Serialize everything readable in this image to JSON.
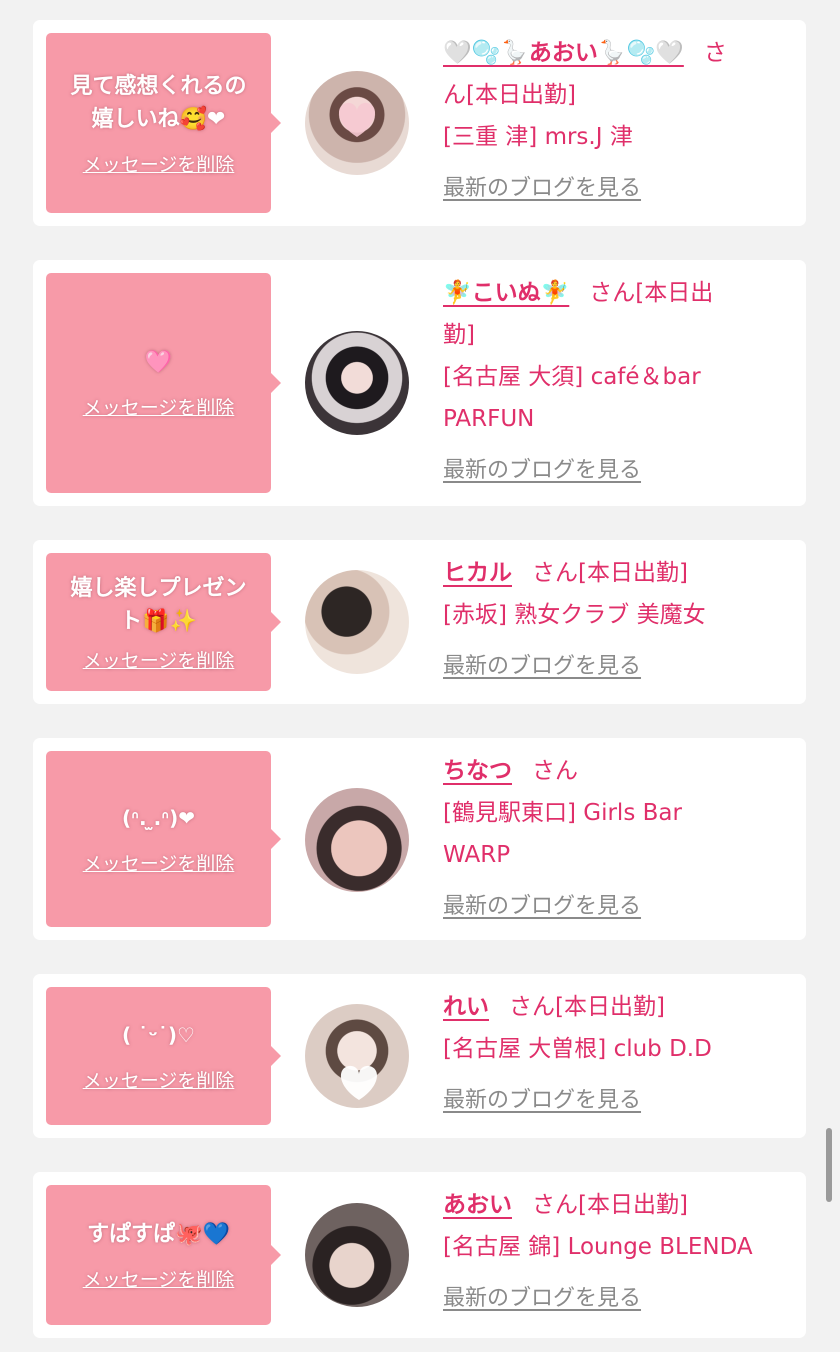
{
  "accent_color": "#e02f6a",
  "bubble_color": "#f79aa8",
  "delete_label": "メッセージを削除",
  "blog_label": "最新のブログを見る",
  "cards": [
    {
      "message": "見て感想くれるの\n嬉しいね🥰❤",
      "name": "🤍🫧🪿あおい🪿🫧🤍",
      "san_line": "さ",
      "line2": "ん[本日出勤]",
      "line3": "[三重 津] mrs.J 津",
      "line4": ""
    },
    {
      "message": "🩷",
      "name": "🧚こいぬ🧚",
      "san_line": "さん[本日出",
      "line2": "勤]",
      "line3": "[名古屋 大須] café＆bar",
      "line4": "PARFUN"
    },
    {
      "message": "嬉し楽しプレゼン\nト🎁✨",
      "name": "ヒカル",
      "san_line": "さん[本日出勤]",
      "line2": "[赤坂] 熟女クラブ 美魔女",
      "line3": "",
      "line4": ""
    },
    {
      "message": "(ᐢ.  ̫.ᐢ)❤",
      "name": "ちなつ",
      "san_line": "さん",
      "line2": "[鶴見駅東口] Girls Bar",
      "line3": "WARP",
      "line4": ""
    },
    {
      "message": "( ˙ᵕ˙)♡",
      "name": "れい",
      "san_line": "さん[本日出勤]",
      "line2": "[名古屋 大曽根] club D.D",
      "line3": "",
      "line4": ""
    },
    {
      "message": "すぱすぱ🐙💙",
      "name": "あおい",
      "san_line": "さん[本日出勤]",
      "line2": "[名古屋 錦] Lounge BLENDA",
      "line3": "",
      "line4": ""
    }
  ]
}
